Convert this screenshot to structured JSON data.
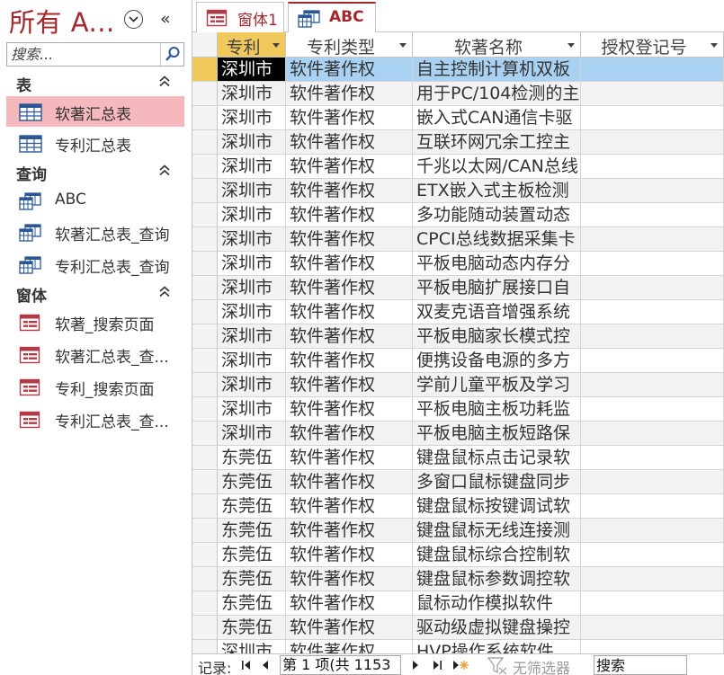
{
  "nav": {
    "title": "所有 A...",
    "search_placeholder": "搜索...",
    "groups": [
      {
        "label": "表",
        "items": [
          {
            "label": "软著汇总表",
            "icon": "table-icon",
            "selected": true
          },
          {
            "label": "专利汇总表",
            "icon": "table-icon",
            "selected": false
          }
        ]
      },
      {
        "label": "查询",
        "items": [
          {
            "label": "ABC",
            "icon": "query-icon",
            "selected": false
          },
          {
            "label": "软著汇总表_查询",
            "icon": "query-icon",
            "selected": false
          },
          {
            "label": "专利汇总表_查询",
            "icon": "query-icon",
            "selected": false
          }
        ]
      },
      {
        "label": "窗体",
        "items": [
          {
            "label": "软著_搜索页面",
            "icon": "form-icon",
            "selected": false
          },
          {
            "label": "软著汇总表_查...",
            "icon": "form-icon",
            "selected": false
          },
          {
            "label": "专利_搜索页面",
            "icon": "form-icon",
            "selected": false
          },
          {
            "label": "专利汇总表_查...",
            "icon": "form-icon",
            "selected": false
          }
        ]
      }
    ]
  },
  "tabs": [
    {
      "label": "窗体1",
      "icon": "form-icon",
      "active": false
    },
    {
      "label": "ABC",
      "icon": "query-icon",
      "active": true
    }
  ],
  "grid": {
    "columns": [
      "专利",
      "专利类型",
      "软著名称",
      "授权登记号"
    ],
    "rows": [
      [
        "深圳市",
        "软件著作权",
        "自主控制计算机双板",
        ""
      ],
      [
        "深圳市",
        "软件著作权",
        "用于PC/104检测的主",
        ""
      ],
      [
        "深圳市",
        "软件著作权",
        "嵌入式CAN通信卡驱",
        ""
      ],
      [
        "深圳市",
        "软件著作权",
        "互联环网冗余工控主",
        ""
      ],
      [
        "深圳市",
        "软件著作权",
        "千兆以太网/CAN总线",
        ""
      ],
      [
        "深圳市",
        "软件著作权",
        "ETX嵌入式主板检测",
        ""
      ],
      [
        "深圳市",
        "软件著作权",
        "多功能随动装置动态",
        ""
      ],
      [
        "深圳市",
        "软件著作权",
        "CPCI总线数据采集卡",
        ""
      ],
      [
        "深圳市",
        "软件著作权",
        "平板电脑动态内存分",
        ""
      ],
      [
        "深圳市",
        "软件著作权",
        "平板电脑扩展接口自",
        ""
      ],
      [
        "深圳市",
        "软件著作权",
        "双麦克语音增强系统",
        ""
      ],
      [
        "深圳市",
        "软件著作权",
        "平板电脑家长模式控",
        ""
      ],
      [
        "深圳市",
        "软件著作权",
        "便携设备电源的多方",
        ""
      ],
      [
        "深圳市",
        "软件著作权",
        "学前儿童平板及学习",
        ""
      ],
      [
        "深圳市",
        "软件著作权",
        "平板电脑主板功耗监",
        ""
      ],
      [
        "深圳市",
        "软件著作权",
        "平板电脑主板短路保",
        ""
      ],
      [
        "东莞伍",
        "软件著作权",
        "键盘鼠标点击记录软",
        ""
      ],
      [
        "东莞伍",
        "软件著作权",
        "多窗口鼠标键盘同步",
        ""
      ],
      [
        "东莞伍",
        "软件著作权",
        "键盘鼠标按键调试软",
        ""
      ],
      [
        "东莞伍",
        "软件著作权",
        "键盘鼠标无线连接测",
        ""
      ],
      [
        "东莞伍",
        "软件著作权",
        "键盘鼠标综合控制软",
        ""
      ],
      [
        "东莞伍",
        "软件著作权",
        "键盘鼠标参数调控软",
        ""
      ],
      [
        "东莞伍",
        "软件著作权",
        "鼠标动作模拟软件",
        ""
      ],
      [
        "东莞伍",
        "软件著作权",
        "驱动级虚拟键盘操控",
        ""
      ],
      [
        "深圳市",
        "软件著作权",
        "HVP操作系统软件",
        ""
      ]
    ]
  },
  "record_nav": {
    "label": "记录:",
    "position": "第 1 项(共 1153",
    "filter_label": "无筛选器",
    "search_placeholder": "搜索"
  }
}
